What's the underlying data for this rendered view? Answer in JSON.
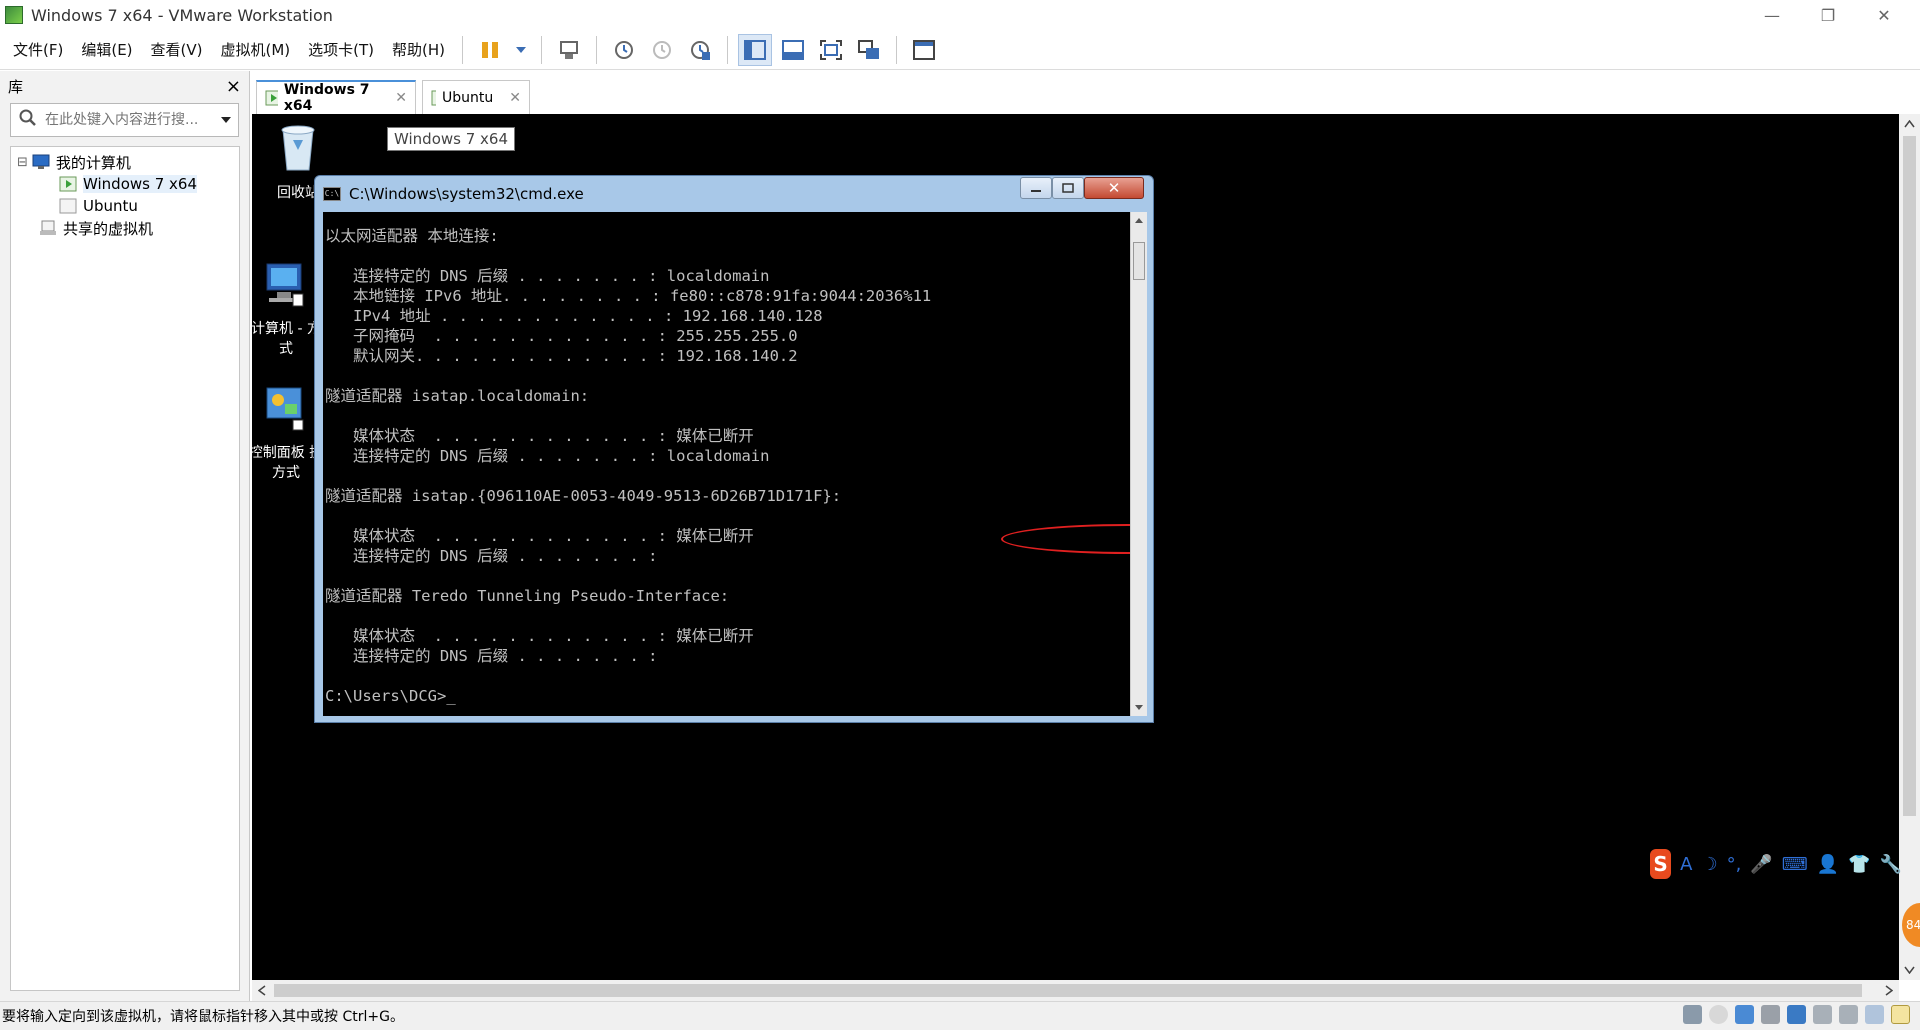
{
  "window": {
    "title": "Windows 7 x64 - VMware Workstation",
    "minimize": "—",
    "restore": "❐",
    "close": "✕"
  },
  "menu": {
    "items": [
      "文件(F)",
      "编辑(E)",
      "查看(V)",
      "虚拟机(M)",
      "选项卡(T)",
      "帮助(H)"
    ]
  },
  "toolbar": {
    "buttons": [
      "pause-icon",
      "dropdown-icon",
      "send-ctrl-alt-del-icon",
      "snapshot-icon",
      "revert-snapshot-icon",
      "snapshot-manager-icon",
      "show-library-icon",
      "thumbnail-bar-icon",
      "full-screen-icon",
      "unity-icon",
      "console-view-icon"
    ]
  },
  "library": {
    "title": "库",
    "close": "×",
    "search_placeholder": "在此处键入内容进行搜...",
    "tree": [
      {
        "label": "我的计算机",
        "expander": "⊟",
        "level": 0
      },
      {
        "label": "Windows 7 x64",
        "level": 1,
        "selected": true
      },
      {
        "label": "Ubuntu",
        "level": 1
      },
      {
        "label": "共享的虚拟机",
        "level": 0
      }
    ]
  },
  "tabs": [
    {
      "label": "Windows 7 x64",
      "close": "✕",
      "active": true
    },
    {
      "label": "Ubuntu",
      "close": "✕",
      "active": false
    }
  ],
  "desktop": {
    "tooltip": "Windows 7 x64",
    "icons": [
      {
        "label": "回收站",
        "icon": "recycle-bin-icon"
      },
      {
        "label": "计算机 - 方式",
        "icon": "computer-icon"
      },
      {
        "label": "控制面板 捷方式",
        "icon": "control-panel-icon"
      }
    ]
  },
  "cmd": {
    "title": "C:\\Windows\\system32\\cmd.exe",
    "icon_text": "C:\\",
    "lines": [
      "以太网适配器 本地连接:",
      "",
      "   连接特定的 DNS 后缀 . . . . . . . : localdomain",
      "   本地链接 IPv6 地址. . . . . . . . : fe80::c878:91fa:9044:2036%11",
      "   IPv4 地址 . . . . . . . . . . . . : 192.168.140.128",
      "   子网掩码  . . . . . . . . . . . . : 255.255.255.0",
      "   默认网关. . . . . . . . . . . . . : 192.168.140.2",
      "",
      "隧道适配器 isatap.localdomain:",
      "",
      "   媒体状态  . . . . . . . . . . . . : 媒体已断开",
      "   连接特定的 DNS 后缀 . . . . . . . : localdomain",
      "",
      "隧道适配器 isatap.{096110AE-0053-4049-9513-6D26B71D171F}:",
      "",
      "   媒体状态  . . . . . . . . . . . . : 媒体已断开",
      "   连接特定的 DNS 后缀 . . . . . . . :",
      "",
      "隧道适配器 Teredo Tunneling Pseudo-Interface:",
      "",
      "   媒体状态  . . . . . . . . . . . . : 媒体已断开",
      "   连接特定的 DNS 后缀 . . . . . . . :",
      "",
      "C:\\Users\\DCG>_"
    ]
  },
  "ime": {
    "logo": "S",
    "items": [
      "A",
      "☽",
      "°,",
      "🎤",
      "⌨",
      "👤",
      "👕",
      "🔧"
    ]
  },
  "badge": "84",
  "colors": {
    "accent": "#4a90d9",
    "console_bg": "#000000",
    "console_fg": "#c0c0c0",
    "highlight_ring": "#e02020",
    "ime_logo": "#e84a1e"
  },
  "statusbar": {
    "message": "要将输入定向到该虚拟机，请将鼠标指针移入其中或按 Ctrl+G。",
    "icons": [
      "hard-disk-icon",
      "cd-rom-icon",
      "network-adapter-icon",
      "printer-icon",
      "sound-icon",
      "usb-icon",
      "usb2-icon",
      "display-icon",
      "message-icon"
    ]
  }
}
